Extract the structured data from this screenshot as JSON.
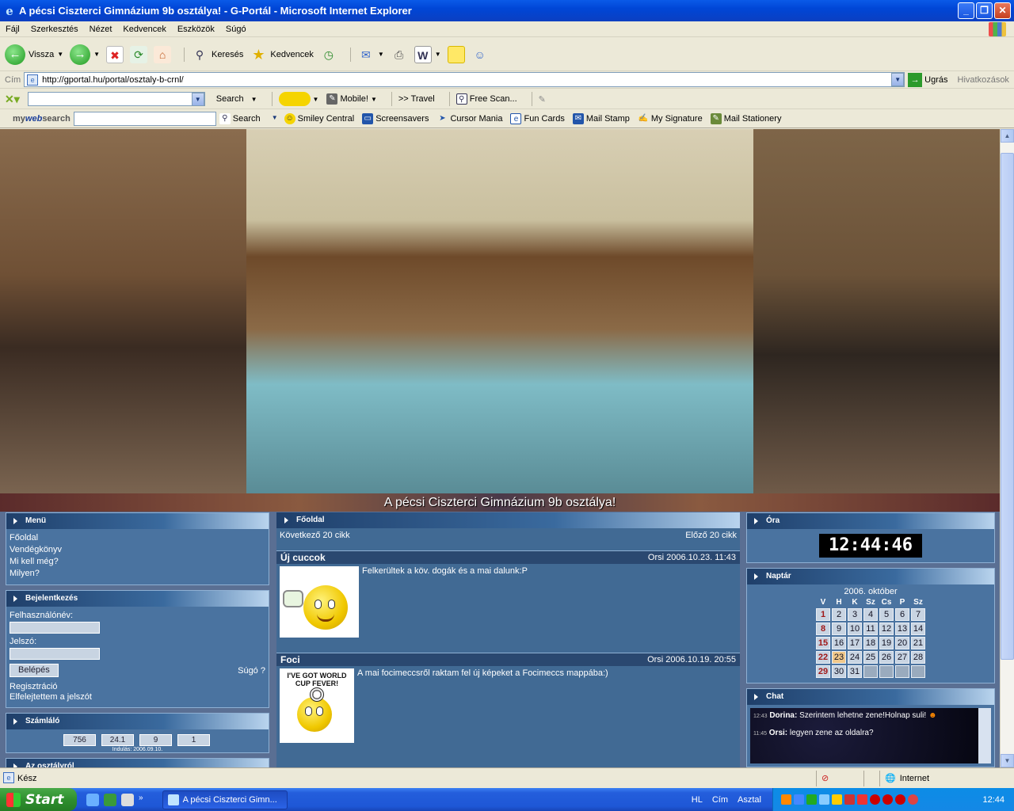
{
  "window": {
    "title": "A pécsi Ciszterci Gimnázium 9b osztálya! - G-Portál - Microsoft Internet Explorer"
  },
  "menu": [
    "Fájl",
    "Szerkesztés",
    "Nézet",
    "Kedvencek",
    "Eszközök",
    "Súgó"
  ],
  "toolbar": {
    "back": "Vissza",
    "search": "Keresés",
    "favorites": "Kedvencek"
  },
  "address": {
    "label": "Cím",
    "url": "http://gportal.hu/portal/osztaly-b-crnl/",
    "go": "Ugrás",
    "links": "Hivatkozások"
  },
  "toolbar2": {
    "search": "Search",
    "mobile": "Mobile!",
    "travel": ">> Travel",
    "freescan": "Free Scan..."
  },
  "toolbar3": {
    "brand_my": "my",
    "brand_web": "web",
    "brand_search": "search",
    "search": "Search",
    "items": [
      "Smiley Central",
      "Screensavers",
      "Cursor Mania",
      "Fun Cards",
      "Mail Stamp",
      "My Signature",
      "Mail Stationery"
    ]
  },
  "page": {
    "banner_title": "A pécsi Ciszterci Gimnázium 9b osztálya!",
    "menu_box": {
      "title": "Menü",
      "items": [
        "Főoldal",
        "Vendégkönyv",
        "Mi kell még?",
        "Milyen?"
      ]
    },
    "login": {
      "title": "Bejelentkezés",
      "username_label": "Felhasználónév:",
      "password_label": "Jelszó:",
      "login_btn": "Belépés",
      "help": "Súgó",
      "register": "Regisztráció",
      "forgot": "Elfelejtettem a jelszót"
    },
    "counter": {
      "title": "Számláló",
      "values": [
        "756",
        "24.1",
        "9",
        "1"
      ],
      "since": "Indulás: 2006.09.10."
    },
    "about": {
      "title": "Az osztályról"
    },
    "main": {
      "title": "Főoldal",
      "next": "Következő 20 cikk",
      "prev": "Előző 20 cikk",
      "articles": [
        {
          "title": "Új cuccok",
          "meta": "Orsi 2006.10.23. 11:43",
          "text": "Felkerültek a köv. dogák és a mai dalunk:P"
        },
        {
          "title": "Foci",
          "meta": "Orsi 2006.10.19. 20:55",
          "text": "A mai focimeccsről raktam fel új képeket a Focimeccs mappába:)",
          "img_text": "I'VE GOT WORLD CUP FEVER!"
        }
      ]
    },
    "clock": {
      "title": "Óra",
      "time": "12:44:46"
    },
    "calendar": {
      "title": "Naptár",
      "month": "2006. október",
      "weekdays": [
        "V",
        "H",
        "K",
        "Sz",
        "Cs",
        "P",
        "Sz"
      ],
      "weeks": [
        [
          "1",
          "2",
          "3",
          "4",
          "5",
          "6",
          "7"
        ],
        [
          "8",
          "9",
          "10",
          "11",
          "12",
          "13",
          "14"
        ],
        [
          "15",
          "16",
          "17",
          "18",
          "19",
          "20",
          "21"
        ],
        [
          "22",
          "23",
          "24",
          "25",
          "26",
          "27",
          "28"
        ],
        [
          "29",
          "30",
          "31",
          "",
          "",
          "",
          ""
        ]
      ],
      "today": "23"
    },
    "chat": {
      "title": "Chat",
      "messages": [
        {
          "time": "12:43",
          "user": "Dorina:",
          "text": "Szerintem lehetne zene!Holnap suli!"
        },
        {
          "time": "11:45",
          "user": "Orsi:",
          "text": "legyen zene az oldalra?"
        }
      ]
    }
  },
  "status": {
    "text": "Kész",
    "zone": "Internet"
  },
  "taskbar": {
    "start": "Start",
    "task": "A pécsi Ciszterci Gimn...",
    "tray_text": [
      "HL",
      "Cím",
      "Asztal"
    ],
    "time": "12:44"
  }
}
